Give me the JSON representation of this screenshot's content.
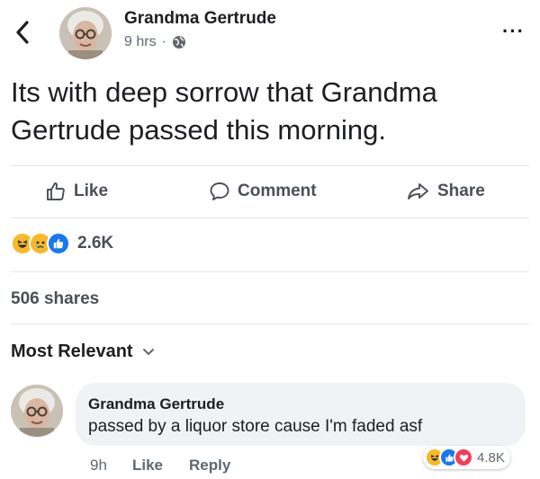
{
  "post": {
    "author": "Grandma Gertrude",
    "time": "9 hrs",
    "separator": "·",
    "text": "Its with deep sorrow that Grandma Gertrude passed this morning.",
    "more_label": "···"
  },
  "actions": {
    "like": "Like",
    "comment": "Comment",
    "share": "Share"
  },
  "reactions": {
    "count": "2.6K",
    "icons": [
      "haha-icon",
      "sad-icon",
      "like-icon"
    ]
  },
  "shares": "506 shares",
  "comments": {
    "sort_label": "Most Relevant",
    "items": [
      {
        "author": "Grandma Gertrude",
        "text": "passed by a liquor store cause I'm faded asf",
        "time": "9h",
        "like_label": "Like",
        "reply_label": "Reply",
        "reaction_count": "4.8K"
      }
    ]
  },
  "colors": {
    "like_blue": "#1877f2",
    "love_red": "#f33e58",
    "haha_yellow": "#f7b928",
    "text_secondary": "#606770",
    "bubble_bg": "#f0f2f5"
  }
}
